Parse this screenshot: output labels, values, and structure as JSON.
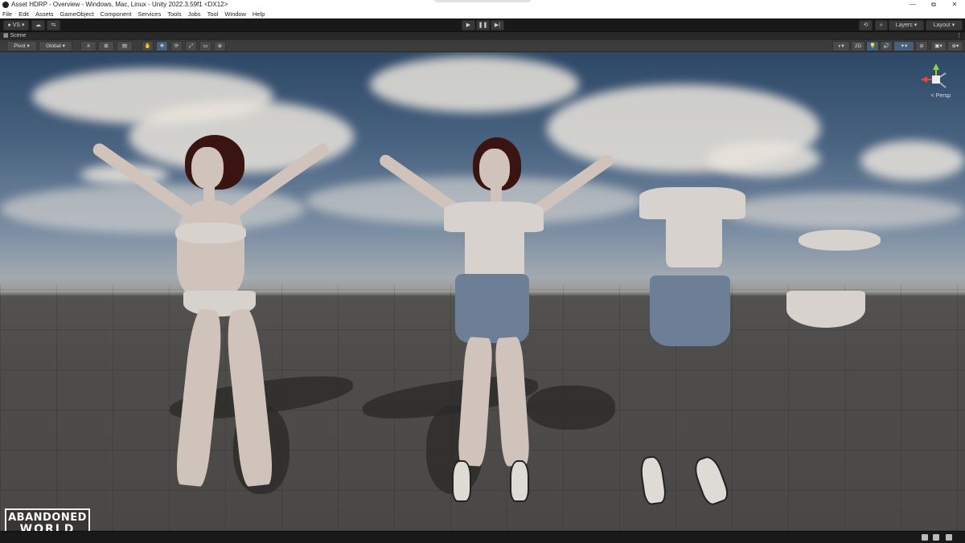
{
  "window": {
    "title": "Asset HDRP - Overview - Windows, Mac, Linux - Unity 2022.3.59f1 <DX12>",
    "controls": [
      "—",
      "⧉",
      "✕"
    ]
  },
  "menu": [
    "File",
    "Edit",
    "Assets",
    "GameObject",
    "Component",
    "Services",
    "Tools",
    "Jobs",
    "Tool",
    "Window",
    "Help"
  ],
  "toolbar": {
    "account_label": "VS",
    "layers_label": "Layers",
    "layout_label": "Layout",
    "play_icons": [
      "▶",
      "❚❚",
      "▶|"
    ]
  },
  "scene": {
    "tab_label": "Scene",
    "pivot_label": "Pivot",
    "global_label": "Global",
    "mode_2d_label": "2D",
    "persp_label": "< Persp"
  },
  "logo": {
    "line1": "ABANDONED",
    "line2": "WORLD"
  }
}
